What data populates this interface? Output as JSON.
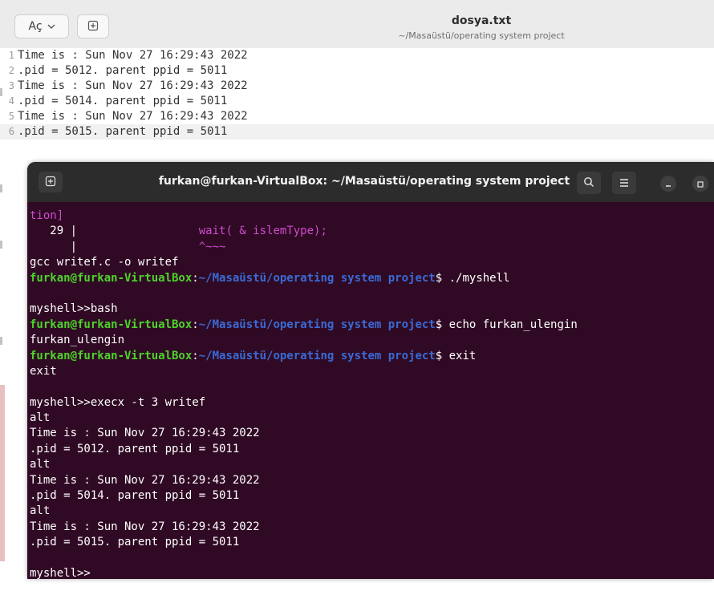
{
  "editor": {
    "open_label": "Aç",
    "title": "dosya.txt",
    "subtitle": "~/Masaüstü/operating system project",
    "lines": [
      {
        "num": "1",
        "text": "Time is : Sun Nov 27 16:29:43 2022"
      },
      {
        "num": "2",
        "text": ".pid = 5012. parent ppid = 5011"
      },
      {
        "num": "3",
        "text": "Time is : Sun Nov 27 16:29:43 2022"
      },
      {
        "num": "4",
        "text": ".pid = 5014. parent ppid = 5011"
      },
      {
        "num": "5",
        "text": "Time is : Sun Nov 27 16:29:43 2022"
      },
      {
        "num": "6",
        "text": ".pid = 5015. parent ppid = 5011"
      }
    ]
  },
  "terminal": {
    "title": "furkan@furkan-VirtualBox: ~/Masaüstü/operating system project",
    "lines": {
      "l0": "tion]",
      "l1_num": "   29 |",
      "l1_code": "wait( & islemType);",
      "l2_bar": "      |",
      "l2_caret": "^~~~",
      "l3": "gcc writef.c -o writef",
      "user_host": "furkan@furkan-VirtualBox",
      "colon": ":",
      "path": "~/Masaüstü/operating system project",
      "cmd1": "$ ./myshell",
      "l6": "myshell>>bash",
      "cmd2": "$ echo furkan_ulengin",
      "l8": "furkan_ulengin",
      "cmd3": "$ exit",
      "l10": "exit",
      "l12": "myshell>>execx -t 3 writef",
      "l13": "alt",
      "l14": "Time is : Sun Nov 27 16:29:43 2022",
      "l15": ".pid = 5012. parent ppid = 5011",
      "l16": "alt",
      "l17": "Time is : Sun Nov 27 16:29:43 2022",
      "l18": ".pid = 5014. parent ppid = 5011",
      "l19": "alt",
      "l20": "Time is : Sun Nov 27 16:29:43 2022",
      "l21": ".pid = 5015. parent ppid = 5011",
      "l23": "myshell>>"
    }
  },
  "colors": {
    "terminal_bg": "#300a24",
    "prompt_user": "#4dd32b",
    "prompt_path": "#3a6ad6",
    "keyword": "#d14ad1"
  }
}
